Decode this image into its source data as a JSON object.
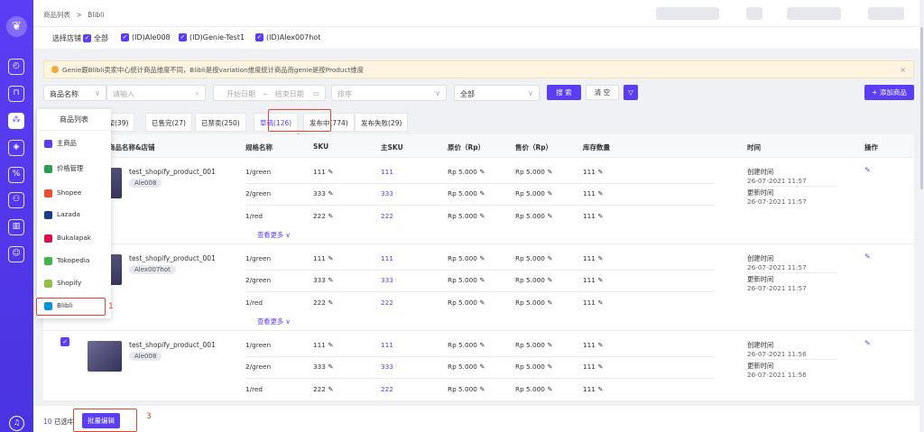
{
  "nav": {
    "logo": "logo-icon",
    "items": [
      "dashboard-icon",
      "orders-icon",
      "products-icon",
      "inventory-icon",
      "promotion-icon",
      "users-icon",
      "reports-icon",
      "chat-icon"
    ],
    "help": "headset-icon"
  },
  "breadcrumb": {
    "root": "商品列表",
    "sep": ">",
    "current": "Blibli"
  },
  "shops": {
    "label": "选择店铺",
    "options": [
      "全部",
      "(ID)Ale008",
      "(ID)Genie-Test1",
      "(ID)Alex007hot"
    ]
  },
  "notice": {
    "text": "Genie跟Blibli卖家中心统计商品维度不同，Blibli是按variation维度统计商品而genie是按Product维度",
    "close": "×"
  },
  "filters": {
    "field": "商品名称",
    "search_placeholder": "请输入",
    "date_start": "开始日期",
    "date_sep": "~",
    "date_end": "结束日期",
    "sort_placeholder": "排序",
    "status": "全部",
    "search_btn": "搜 索",
    "clear_btn": "清 空",
    "add_btn": "+ 添加商品"
  },
  "tabs": [
    "下架(39)",
    "已售完(27)",
    "已禁卖(250)",
    "草稿(126)",
    "发布中(774)",
    "发布失败(29)"
  ],
  "table": {
    "headers": [
      "商品名称&店铺",
      "规格名称",
      "SKU",
      "主SKU",
      "原价（Rp）",
      "售价（Rp）",
      "库存数量",
      "时间",
      "操作"
    ],
    "more": "查看更多 ∨",
    "created_label": "创建时间",
    "updated_label": "更新时间",
    "groups": [
      {
        "name": "test_shopify_product_001",
        "shop": "Ale008",
        "created": "26-07-2021 11:57",
        "updated": "26-07-2021 11:57",
        "rows": [
          [
            "1/green",
            "111",
            "111",
            "Rp 5.000",
            "Rp 5.000",
            "111"
          ],
          [
            "2/green",
            "333",
            "333",
            "Rp 5.000",
            "Rp 5.000",
            "111"
          ],
          [
            "1/red",
            "222",
            "222",
            "Rp 5.000",
            "Rp 5.000",
            "111"
          ]
        ]
      },
      {
        "name": "test_shopify_product_001",
        "shop": "Alex007hot",
        "created": "26-07-2021 11:57",
        "updated": "26-07-2021 11:57",
        "rows": [
          [
            "1/green",
            "111",
            "111",
            "Rp 5.000",
            "Rp 5.000",
            "111"
          ],
          [
            "2/green",
            "333",
            "333",
            "Rp 5.000",
            "Rp 5.000",
            "111"
          ],
          [
            "1/red",
            "222",
            "222",
            "Rp 5.000",
            "Rp 5.000",
            "111"
          ]
        ]
      },
      {
        "name": "test_shopify_product_001",
        "shop": "Ale008",
        "created": "26-07-2021 11:56",
        "updated": "26-07-2021 11:56",
        "rows": [
          [
            "1/green",
            "111",
            "111",
            "Rp 5.000",
            "Rp 5.000",
            "111"
          ],
          [
            "2/green",
            "333",
            "333",
            "Rp 5.000",
            "Rp 5.000",
            "111"
          ],
          [
            "1/red",
            "222",
            "222",
            "Rp 5.000",
            "Rp 5.000",
            "111"
          ]
        ]
      }
    ]
  },
  "footer": {
    "count": "10",
    "selected": "已选中",
    "batch_btn": "批量编辑"
  },
  "menu": {
    "title": "商品列表",
    "items": [
      {
        "label": "主商品",
        "color": "#5b3df5"
      },
      {
        "label": "价格管理",
        "color": "#2e9d54"
      },
      {
        "label": "Shopee",
        "color": "#ee4d2d"
      },
      {
        "label": "Lazada",
        "color": "#1a3c8f"
      },
      {
        "label": "Bukalapak",
        "color": "#d71149"
      },
      {
        "label": "Tokopedia",
        "color": "#42b549"
      },
      {
        "label": "Shopify",
        "color": "#95bf47"
      },
      {
        "label": "Blibli",
        "color": "#0095da"
      }
    ]
  },
  "markers": [
    "1",
    "2",
    "3"
  ]
}
